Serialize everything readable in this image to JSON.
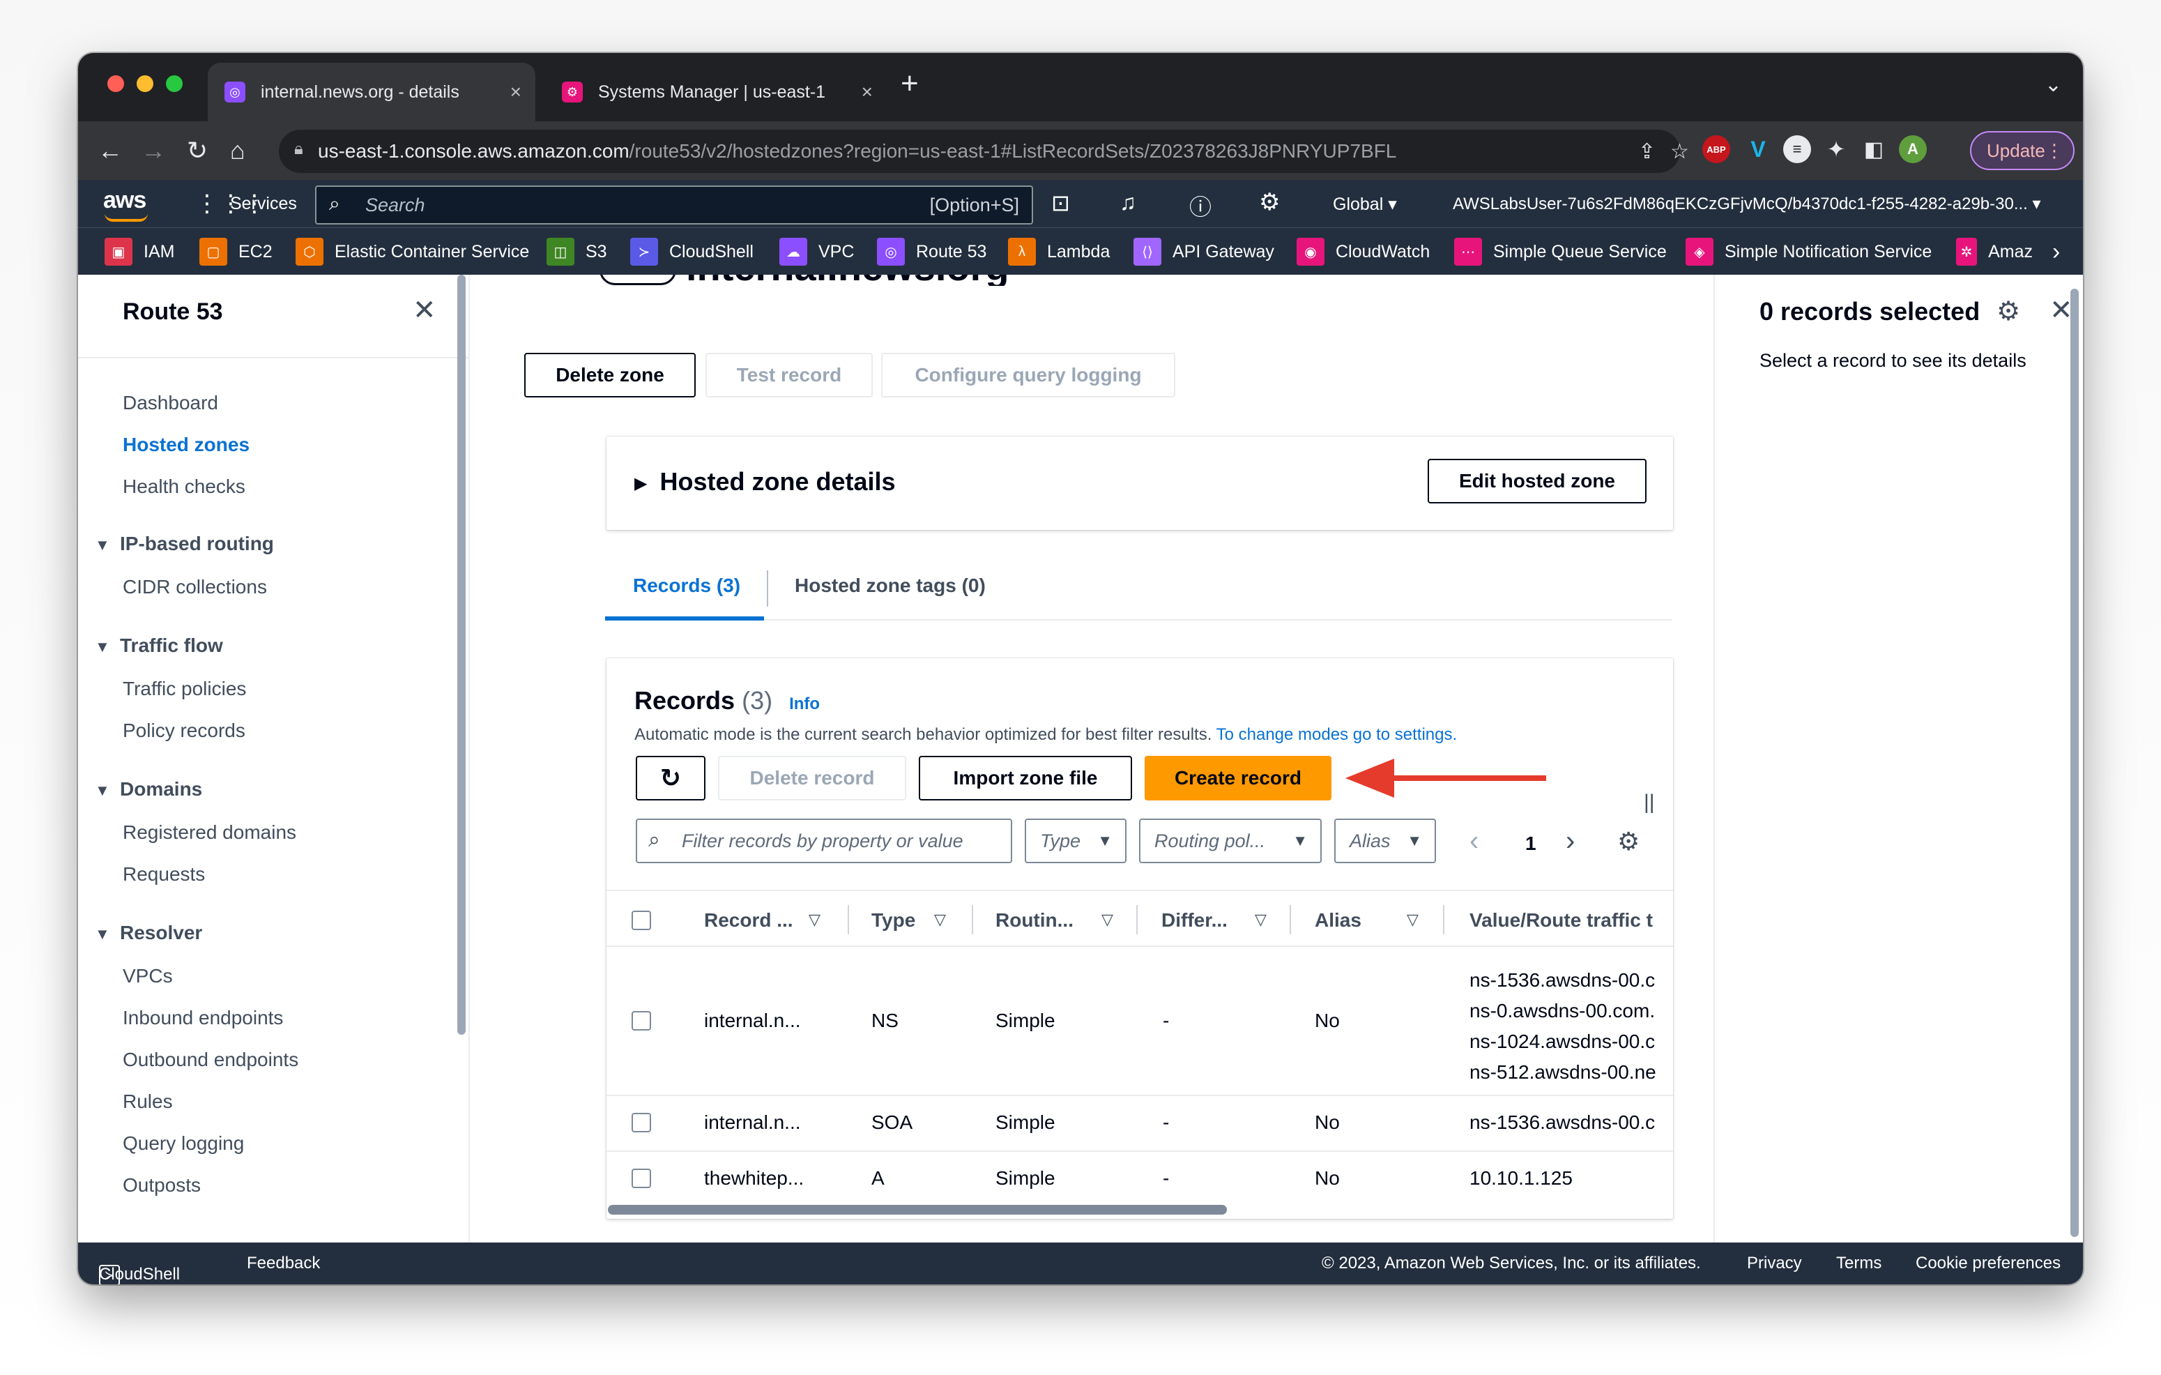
{
  "browser": {
    "tabs": [
      {
        "title": "internal.news.org - details",
        "active": true
      },
      {
        "title": "Systems Manager | us-east-1",
        "active": false
      }
    ],
    "url": {
      "host": "us-east-1.console.aws.amazon.com",
      "path": "/route53/v2/hostedzones?region=us-east-1#ListRecordSets/Z02378263J8PNRYUP7BFL"
    },
    "profile_initial": "A",
    "extension_abp": "ABP",
    "update_label": "Update"
  },
  "awsnav": {
    "logo": "aws",
    "services_label": "Services",
    "search_placeholder": "Search",
    "search_shortcut": "[Option+S]",
    "region_label": "Global",
    "account_label": "AWSLabsUser-7u6s2FdM86qEKCzGFjvMcQ/b4370dc1-f255-4282-a29b-30..."
  },
  "favorites": [
    {
      "label": "IAM",
      "color": "#dd344c"
    },
    {
      "label": "EC2",
      "color": "#ed7100"
    },
    {
      "label": "Elastic Container Service",
      "color": "#ed7100"
    },
    {
      "label": "S3",
      "color": "#3f8624"
    },
    {
      "label": "CloudShell",
      "color": "#5a5ae6"
    },
    {
      "label": "VPC",
      "color": "#8c4fff"
    },
    {
      "label": "Route 53",
      "color": "#8c4fff"
    },
    {
      "label": "Lambda",
      "color": "#ed7100"
    },
    {
      "label": "API Gateway",
      "color": "#a166ff"
    },
    {
      "label": "CloudWatch",
      "color": "#e7157b"
    },
    {
      "label": "Simple Queue Service",
      "color": "#e7157b"
    },
    {
      "label": "Simple Notification Service",
      "color": "#e7157b"
    },
    {
      "label": "Amaz",
      "color": "#e7157b"
    }
  ],
  "sidebar": {
    "title": "Route 53",
    "items": {
      "dashboard": "Dashboard",
      "hosted_zones": "Hosted zones",
      "health_checks": "Health checks",
      "cidr_collections": "CIDR collections",
      "traffic_policies": "Traffic policies",
      "policy_records": "Policy records",
      "registered_domains": "Registered domains",
      "requests": "Requests",
      "vpcs": "VPCs",
      "inbound_endpoints": "Inbound endpoints",
      "outbound_endpoints": "Outbound endpoints",
      "rules": "Rules",
      "query_logging": "Query logging",
      "outposts": "Outposts"
    },
    "sections": {
      "ip_routing": "IP-based routing",
      "traffic_flow": "Traffic flow",
      "domains": "Domains",
      "resolver": "Resolver"
    }
  },
  "main": {
    "zone_title_partial": "internal.news.org",
    "actions": {
      "delete_zone": "Delete zone",
      "test_record": "Test record",
      "configure_logging": "Configure query logging"
    },
    "details": {
      "title": "Hosted zone details",
      "edit_label": "Edit hosted zone"
    },
    "tabs": {
      "records": "Records (3)",
      "tags": "Hosted zone tags (0)"
    },
    "records": {
      "title": "Records",
      "count": "(3)",
      "info": "Info",
      "description": "Automatic mode is the current search behavior optimized for best filter results.",
      "settings_link": "To change modes go to settings.",
      "delete_label": "Delete record",
      "import_label": "Import zone file",
      "create_label": "Create record",
      "filter_placeholder": "Filter records by property or value",
      "type_filter": "Type",
      "routing_filter": "Routing pol...",
      "alias_filter": "Alias",
      "page_number": "1",
      "columns": [
        "Record ...",
        "Type",
        "Routin...",
        "Differ...",
        "Alias",
        "Value/Route traffic t"
      ],
      "rows": [
        {
          "name": "internal.n...",
          "type": "NS",
          "routing": "Simple",
          "differ": "-",
          "alias": "No",
          "values": [
            "ns-1536.awsdns-00.c",
            "ns-0.awsdns-00.com.",
            "ns-1024.awsdns-00.c",
            "ns-512.awsdns-00.ne"
          ]
        },
        {
          "name": "internal.n...",
          "type": "SOA",
          "routing": "Simple",
          "differ": "-",
          "alias": "No",
          "values": [
            "ns-1536.awsdns-00.c"
          ]
        },
        {
          "name": "thewhitep...",
          "type": "A",
          "routing": "Simple",
          "differ": "-",
          "alias": "No",
          "values": [
            "10.10.1.125"
          ]
        }
      ]
    }
  },
  "rpanel": {
    "title": "0 records selected",
    "hint": "Select a record to see its details"
  },
  "footer": {
    "cloudshell": "CloudShell",
    "feedback": "Feedback",
    "copyright": "© 2023, Amazon Web Services, Inc. or its affiliates.",
    "privacy": "Privacy",
    "terms": "Terms",
    "cookies": "Cookie preferences"
  },
  "colors": {
    "accent": "#0972d3",
    "primary_button": "#ff9900",
    "nav_bg": "#232f3e",
    "annotation_arrow": "#e53b2c"
  }
}
